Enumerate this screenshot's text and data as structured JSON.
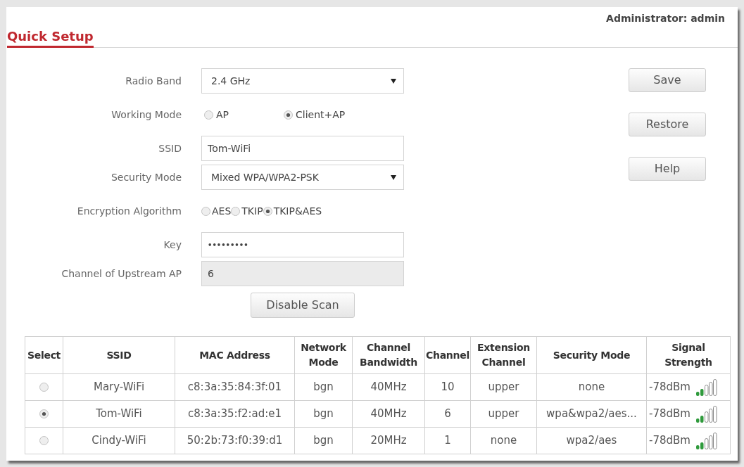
{
  "header": {
    "user": "Administrator: admin"
  },
  "page_title": "Quick Setup",
  "form": {
    "fields": [
      {
        "kind": "select",
        "label": "Radio Band",
        "value": "2.4 GHz"
      },
      {
        "kind": "radio",
        "label": "Working Mode",
        "options": [
          {
            "label": "AP",
            "selected": false
          },
          {
            "label": "Client+AP",
            "selected": true
          }
        ]
      },
      {
        "kind": "text",
        "label": "SSID",
        "value": "Tom-WiFi",
        "disabled": false
      },
      {
        "kind": "select",
        "label": "Security Mode",
        "value": "Mixed WPA/WPA2-PSK"
      },
      {
        "kind": "radio_inline",
        "label": "Encryption Algorithm",
        "options": [
          {
            "label": "AES",
            "selected": false
          },
          {
            "label": "TKIP",
            "selected": false
          },
          {
            "label": "TKIP&AES",
            "selected": true
          }
        ]
      },
      {
        "kind": "password",
        "label": "Key",
        "value": "•••••••••",
        "disabled": false
      },
      {
        "kind": "text",
        "label": "Channel of Upstream AP",
        "value": "6",
        "disabled": true
      }
    ],
    "scan_button": "Disable Scan"
  },
  "actions": [
    "Save",
    "Restore",
    "Help"
  ],
  "scan_table": {
    "columns": [
      "Select",
      "SSID",
      "MAC Address",
      "Network Mode",
      "Channel Bandwidth",
      "Channel",
      "Extension Channel",
      "Security Mode",
      "Signal Strength"
    ],
    "rows": [
      {
        "selected": false,
        "cells": [
          {
            "kind": "radio"
          },
          {
            "kind": "text",
            "text": "Mary-WiFi"
          },
          {
            "kind": "text",
            "text": "c8:3a:35:84:3f:01"
          },
          {
            "kind": "text",
            "text": "bgn"
          },
          {
            "kind": "text",
            "text": "40MHz"
          },
          {
            "kind": "text",
            "text": "10"
          },
          {
            "kind": "text",
            "text": "upper"
          },
          {
            "kind": "text",
            "text": "none"
          },
          {
            "kind": "signal",
            "text": "-78dBm"
          }
        ]
      },
      {
        "selected": true,
        "cells": [
          {
            "kind": "radio"
          },
          {
            "kind": "text",
            "text": "Tom-WiFi"
          },
          {
            "kind": "text",
            "text": "c8:3a:35:f2:ad:e1"
          },
          {
            "kind": "text",
            "text": "bgn"
          },
          {
            "kind": "text",
            "text": "40MHz"
          },
          {
            "kind": "text",
            "text": "6"
          },
          {
            "kind": "text",
            "text": "upper"
          },
          {
            "kind": "text",
            "text": "wpa&wpa2/aes..."
          },
          {
            "kind": "signal",
            "text": "-78dBm"
          }
        ]
      },
      {
        "selected": false,
        "cells": [
          {
            "kind": "radio"
          },
          {
            "kind": "text",
            "text": "Cindy-WiFi"
          },
          {
            "kind": "text",
            "text": "50:2b:73:f0:39:d1"
          },
          {
            "kind": "text",
            "text": "bgn"
          },
          {
            "kind": "text",
            "text": "20MHz"
          },
          {
            "kind": "text",
            "text": "1"
          },
          {
            "kind": "text",
            "text": "none"
          },
          {
            "kind": "text",
            "text": "wpa2/aes"
          },
          {
            "kind": "signal",
            "text": "-78dBm"
          }
        ]
      }
    ]
  }
}
